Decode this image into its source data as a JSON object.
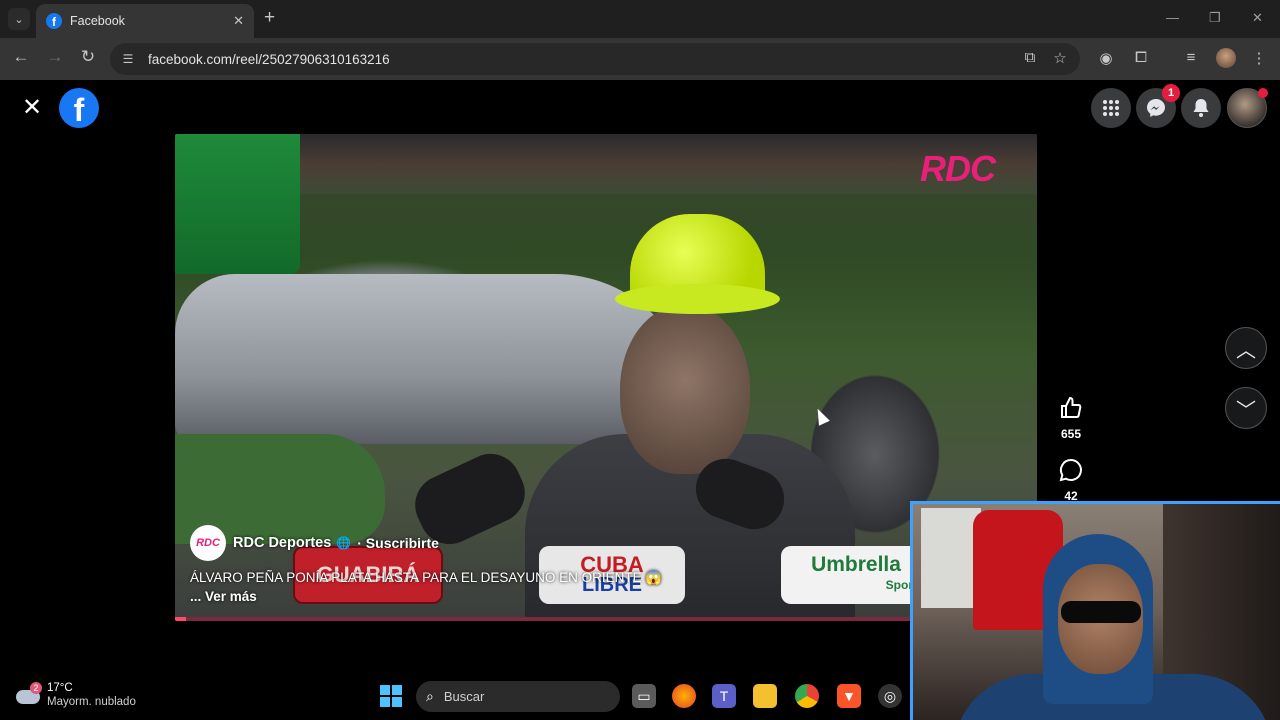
{
  "browser": {
    "tab_title": "Facebook",
    "tab_close": "✕",
    "new_tab": "+",
    "url": "facebook.com/reel/25027906310163216"
  },
  "facebook": {
    "logo": "f",
    "close": "✕",
    "messenger_badge": "1"
  },
  "video": {
    "watermark": "RDC",
    "channel_logo": "RDC",
    "channel_name": "RDC Deportes",
    "subscribe": "· Suscribirte",
    "caption": "ÁLVARO PEÑA PONÍA PLATA HASTA PARA EL DESAYUNO EN ORIENTE 😱",
    "see_more": "... Ver más",
    "sponsor_1": "GUABIRÁ",
    "sponsor_2_top": "CUBA",
    "sponsor_2_bottom": "LIBRE",
    "sponsor_3": "Umbrella",
    "sponsor_3_sub": "Sport",
    "progress": 0.0125
  },
  "actions": {
    "likes": "655",
    "comments": "42"
  },
  "taskbar": {
    "weather_badge": "2",
    "temperature": "17°C",
    "weather_desc": "Mayorm. nublado",
    "search_placeholder": "Buscar"
  },
  "icons": [
    "menu-chevron-icon",
    "facebook-favicon",
    "back-icon",
    "forward-icon",
    "reload-icon",
    "site-info-icon",
    "install-icon",
    "star-icon",
    "extension-icon",
    "puzzle-icon",
    "media-icon",
    "menu-dots-icon",
    "grid-icon",
    "messenger-icon",
    "bell-icon",
    "like-icon",
    "comment-icon",
    "chevron-up-icon",
    "chevron-down-icon",
    "windows-icon",
    "search-icon"
  ]
}
